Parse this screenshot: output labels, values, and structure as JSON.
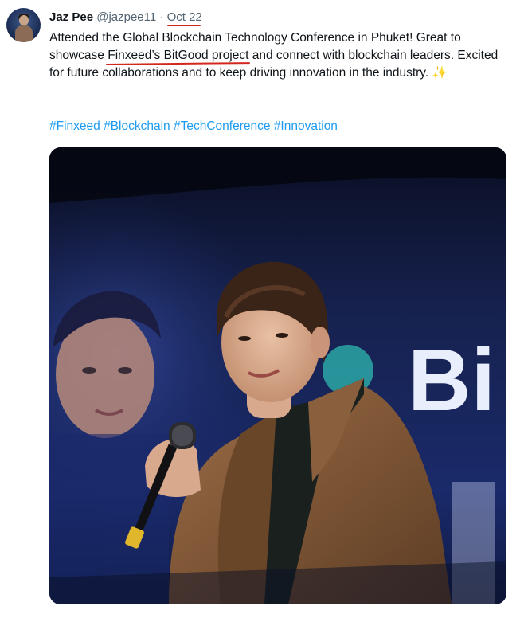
{
  "post": {
    "author_name": "Jaz Pee",
    "handle": "@jazpee11",
    "separator": "·",
    "date": "Oct 22",
    "text_before": "Attended the Global Blockchain Technology Conference in Phuket! Great to showcase ",
    "text_highlight": "Finxeed’s BitGood project",
    "text_after": " and connect with blockchain leaders. Excited for future collaborations and to keep driving innovation in the industry. ",
    "emoji": "✨",
    "hashtags": [
      "#Finxeed",
      "#Blockchain",
      "#TechConference",
      "#Innovation"
    ]
  },
  "media": {
    "screen_text": "Bi"
  },
  "colors": {
    "link": "#1d9bf0",
    "annotation_underline": "#d3271d",
    "muted_text": "#536471"
  }
}
